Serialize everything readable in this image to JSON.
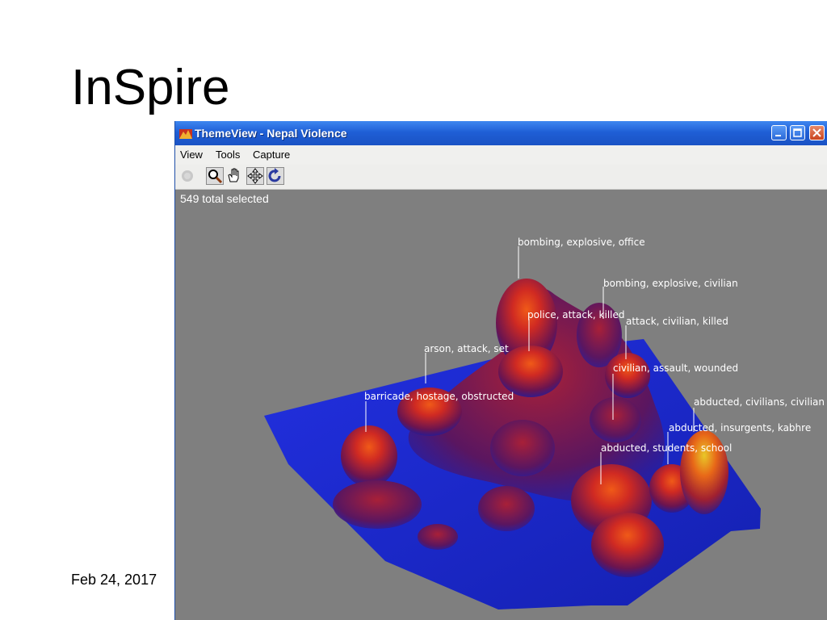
{
  "slide": {
    "title": "InSpire",
    "date": "Feb 24, 2017"
  },
  "window": {
    "title": "ThemeView - Nepal Violence",
    "controls": [
      "minimize-icon",
      "maximize-icon",
      "close-icon"
    ]
  },
  "menu": {
    "items": [
      "View",
      "Tools",
      "Capture"
    ]
  },
  "toolbar": {
    "tools": [
      "select-icon",
      "zoom-icon",
      "hand-icon",
      "move-icon",
      "rotate-icon"
    ]
  },
  "view": {
    "status": "549 total selected"
  },
  "colors": {
    "terrain_low": "#1a22cc",
    "terrain_mid": "#8a1a3a",
    "terrain_high": "#e83010",
    "terrain_peak": "#e8c020"
  },
  "themes": {
    "bombing_office": "bombing, explosive, office",
    "bombing_civilian": "bombing, explosive, civilian",
    "police_attack": "police, attack, killed",
    "attack_civilian": "attack, civilian, killed",
    "arson": "arson, attack, set",
    "civilian_assault": "civilian, assault, wounded",
    "barricade": "barricade, hostage, obstructed",
    "abducted_civilians": "abducted, civilians, civilian",
    "abducted_insurgents": "abducted, insurgents, kabhre",
    "abducted_students": "abducted, students, school"
  }
}
